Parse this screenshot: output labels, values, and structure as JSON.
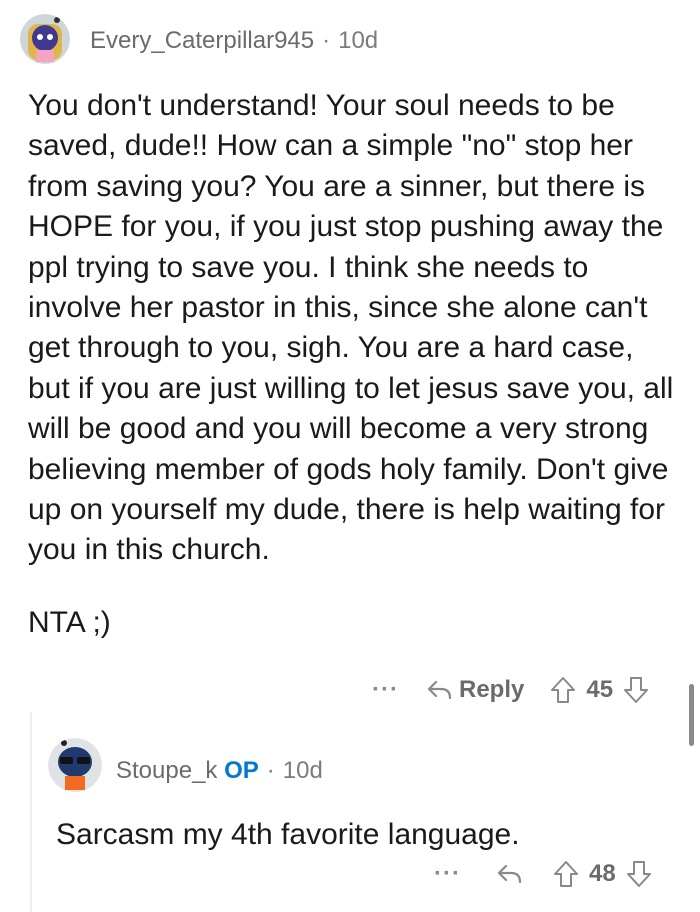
{
  "comments": [
    {
      "username": "Every_Caterpillar945",
      "age": "10d",
      "paragraphs": [
        "You don't understand! Your soul needs to be saved, dude!! How can a simple \"no\" stop her from saving you? You are a sinner, but there is HOPE for you, if you just stop pushing away the ppl trying to save you. I think she needs to involve her pastor in this, since she alone can't get through to you, sigh. You are a hard case, but if you are just willing to let jesus save you, all will be good and you will become a very strong believing member of gods holy family. Don't give up on yourself my dude, there is help waiting for you in this church.",
        "NTA ;)"
      ],
      "more": "···",
      "reply_label": "Reply",
      "score": "45"
    },
    {
      "username": "Stoupe_k",
      "op_badge": "OP",
      "age": "10d",
      "paragraphs": [
        "Sarcasm my 4th favorite language."
      ],
      "more": "···",
      "score": "48"
    }
  ],
  "colors": {
    "op": "#0079d3",
    "meta": "#7c7c7c",
    "text": "#1a1a1b",
    "icon": "#878a8c"
  },
  "icons": [
    "avatar",
    "more-icon",
    "reply-icon",
    "upvote-icon",
    "downvote-icon"
  ]
}
